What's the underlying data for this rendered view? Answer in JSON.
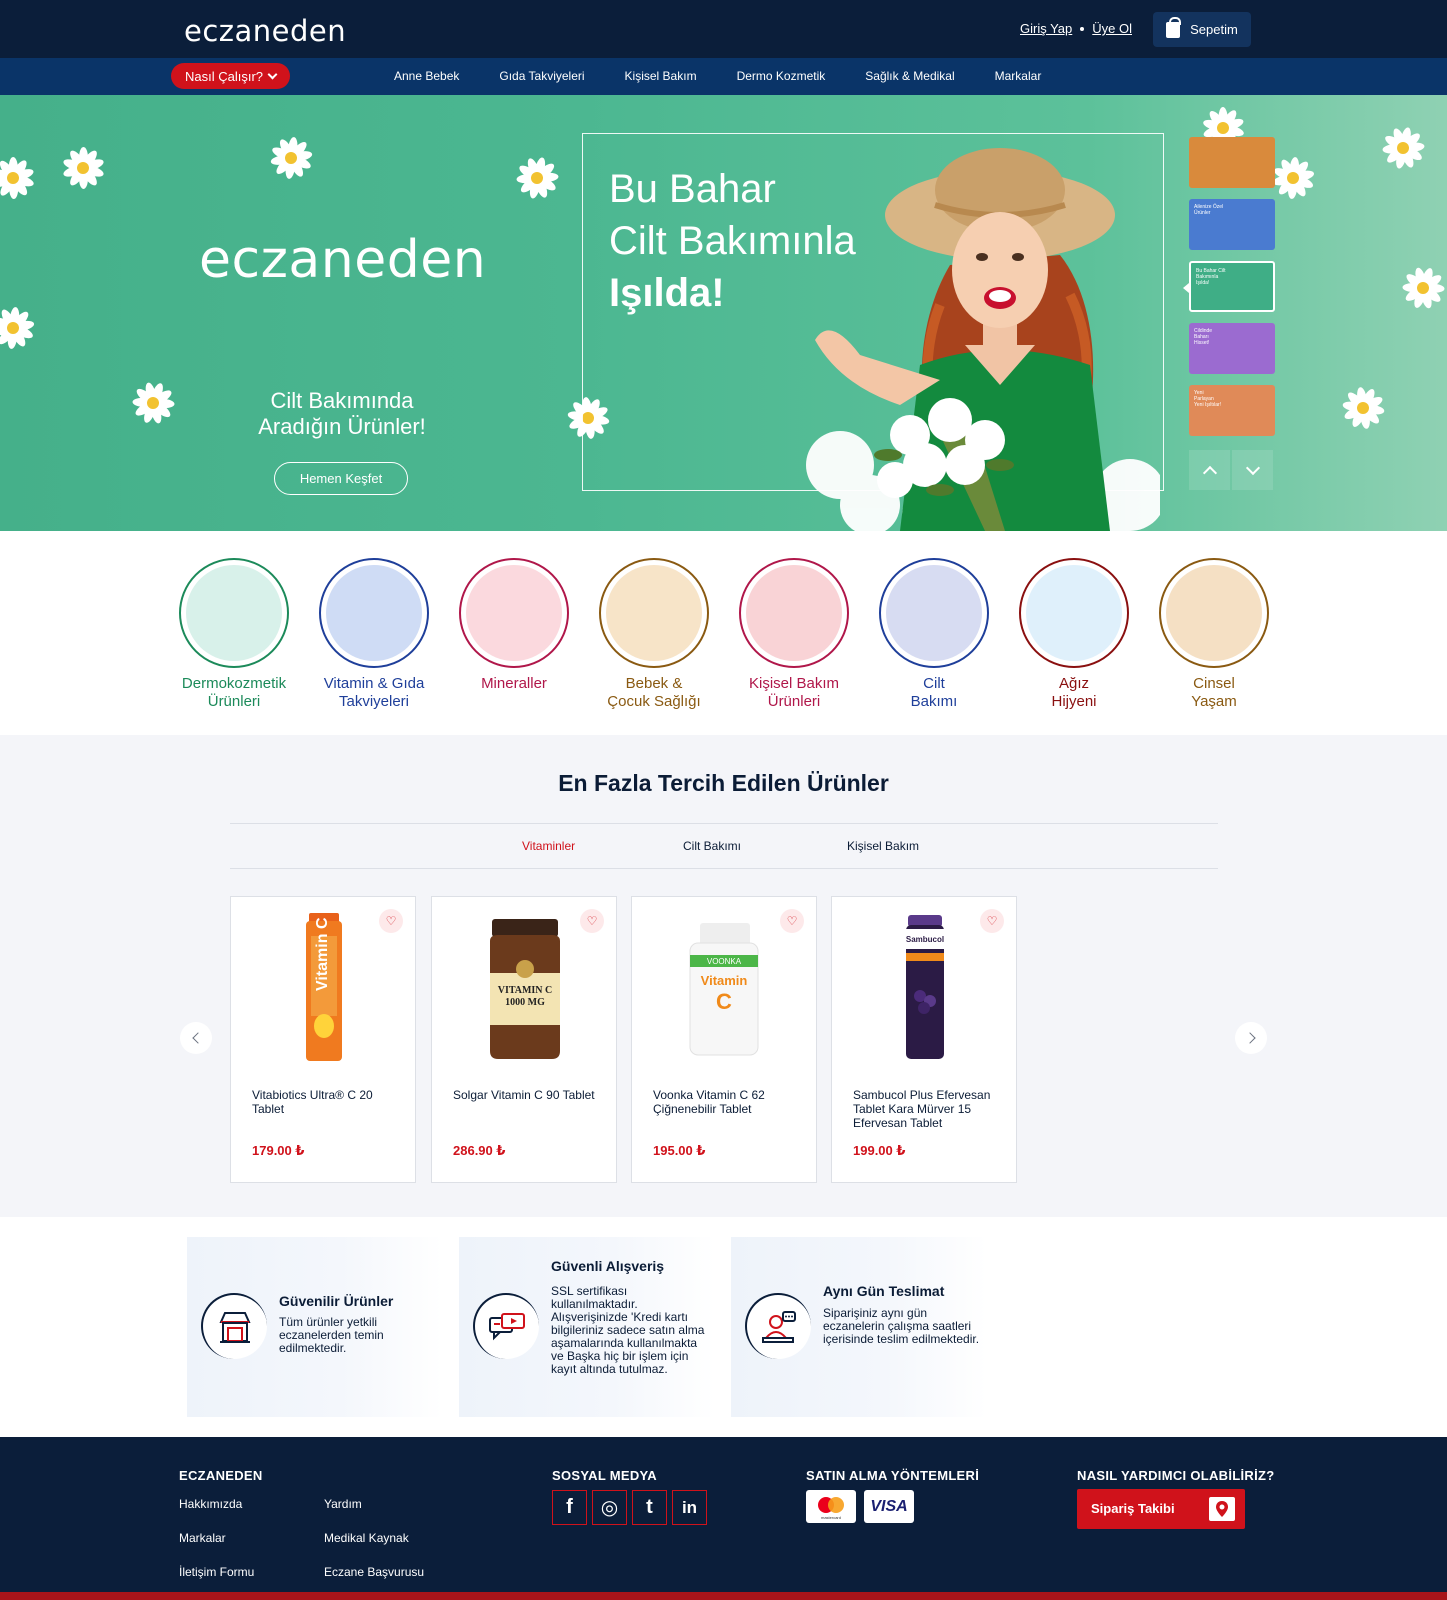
{
  "header": {
    "logo": "eczaneden",
    "login": "Giriş Yap",
    "register": "Üye Ol",
    "cart": "Sepetim",
    "how_it_works": "Nasıl Çalışır?",
    "nav": [
      "Anne Bebek",
      "Gıda Takviyeleri",
      "Kişisel Bakım",
      "Dermo Kozmetik",
      "Sağlık & Medikal",
      "Markalar"
    ]
  },
  "hero": {
    "logo": "eczaneden",
    "subtitle_line1": "Cilt Bakımında",
    "subtitle_line2": "Aradığın Ürünler!",
    "cta": "Hemen Keşfet",
    "title_line1": "Bu Bahar",
    "title_line2": "Cilt Bakımınla",
    "title_line3": "Işılda!",
    "thumbnails": [
      {
        "text": "",
        "color": "#d98a3c"
      },
      {
        "text": "Ailenize Özel Ürünler",
        "color": "#4a7bd0"
      },
      {
        "text": "Bu Bahar Cilt Bakımınla Işılda!",
        "color": "#3fae86"
      },
      {
        "text": "Cildinde Baharı Hisset!",
        "color": "#9b6bd0"
      },
      {
        "text": "Yeni Parlayan Yeni Işıltılar!",
        "color": "#e08a58"
      }
    ]
  },
  "categories": [
    {
      "line1": "Dermokozmetik",
      "line2": "Ürünleri",
      "color": "#1c8a5a",
      "bg": "#d8f1ea"
    },
    {
      "line1": "Vitamin & Gıda",
      "line2": "Takviyeleri",
      "color": "#1f3f9a",
      "bg": "#cfdcf5"
    },
    {
      "line1": "Mineraller",
      "line2": "",
      "color": "#b0174a",
      "bg": "#fbd9de"
    },
    {
      "line1": "Bebek &",
      "line2": "Çocuk Sağlığı",
      "color": "#8a5a12",
      "bg": "#f7e4c8"
    },
    {
      "line1": "Kişisel Bakım",
      "line2": "Ürünleri",
      "color": "#b0174a",
      "bg": "#f9d3d6"
    },
    {
      "line1": "Cilt",
      "line2": "Bakımı",
      "color": "#1f3f9a",
      "bg": "#d7dcf2"
    },
    {
      "line1": "Ağız",
      "line2": "Hijyeni",
      "color": "#8a1010",
      "bg": "#dff0fb"
    },
    {
      "line1": "Cinsel",
      "line2": "Yaşam",
      "color": "#8a5a12",
      "bg": "#f5e0c4"
    }
  ],
  "products_section": {
    "title": "En Fazla Tercih Edilen Ürünler",
    "tabs": [
      "Vitaminler",
      "Cilt Bakımı",
      "Kişisel Bakım"
    ],
    "active_tab": "Vitaminler",
    "products": [
      {
        "name": "Vitabiotics Ultra® C 20 Tablet",
        "price": "179.00 ₺"
      },
      {
        "name": "Solgar Vitamin C 90 Tablet",
        "price": "286.90 ₺"
      },
      {
        "name": "Voonka Vitamin C 62 Çiğnenebilir Tablet",
        "price": "195.00 ₺"
      },
      {
        "name": "Sambucol Plus Efervesan Tablet Kara Mürver 15 Efervesan Tablet",
        "price": "199.00 ₺"
      }
    ]
  },
  "features": [
    {
      "title": "Güvenilir Ürünler",
      "desc": "Tüm ürünler yetkili eczanelerden temin edilmektedir."
    },
    {
      "title": "Güvenli Alışveriş",
      "desc": "SSL sertifikası kullanılmaktadır. Alışverişinizde 'Kredi kartı bilgileriniz sadece satın alma aşamalarında kullanılmakta ve Başka hiç bir işlem için kayıt altında tutulmaz."
    },
    {
      "title": "Aynı Gün Teslimat",
      "desc": "Siparişiniz aynı gün eczanelerin çalışma saatleri içerisinde teslim edilmektedir."
    }
  ],
  "footer": {
    "col1_title": "ECZANEDEN",
    "links_a": [
      "Hakkımızda",
      "Markalar",
      "İletişim Formu"
    ],
    "links_b": [
      "Yardım",
      "Medikal Kaynak",
      "Eczane Başvurusu"
    ],
    "social_title": "SOSYAL MEDYA",
    "social": [
      "f",
      "◎",
      "t",
      "in"
    ],
    "payment_title": "SATIN ALMA YÖNTEMLERİ",
    "mastercard_text": "mastercard",
    "visa_text": "VISA",
    "help_title": "NASIL YARDIMCI OLABİLİRİZ?",
    "track_order": "Sipariş Takibi"
  },
  "colors": {
    "navy": "#0b1e3a",
    "nav_blue": "#0a3468",
    "red": "#d0121b",
    "hero_green": "#4cb791"
  }
}
